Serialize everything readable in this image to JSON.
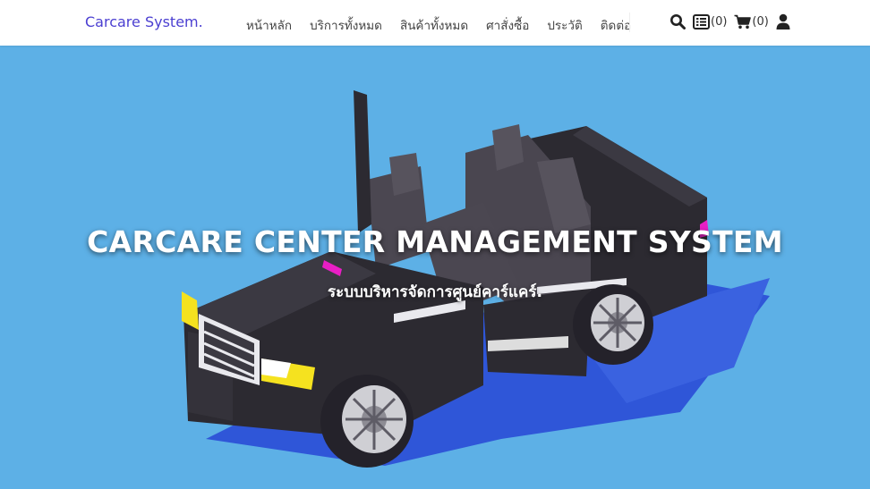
{
  "navbar": {
    "brand": "Carcare System.",
    "links": [
      {
        "label": "หน้าหลัก"
      },
      {
        "label": "บริการทั้งหมด"
      },
      {
        "label": "สินค้าทั้งหมด"
      },
      {
        "label": "ศาสั่งซื้อ"
      },
      {
        "label": "ประวัติ"
      },
      {
        "label": "ติดต่อ"
      }
    ],
    "icons": {
      "search": "search-icon",
      "orders": "list-icon",
      "orders_count": "(0)",
      "cart": "cart-icon",
      "cart_count": "(0)",
      "user": "user-icon"
    }
  },
  "hero": {
    "title": "CARCARE CENTER MANAGEMENT SYSTEM",
    "subtitle": "ระบบบริหารจัดการศูนย์คาร์แคร์.",
    "background_color": "#5db0e6"
  },
  "colors": {
    "brand": "#4b3fd1",
    "nav_text": "#444444"
  }
}
